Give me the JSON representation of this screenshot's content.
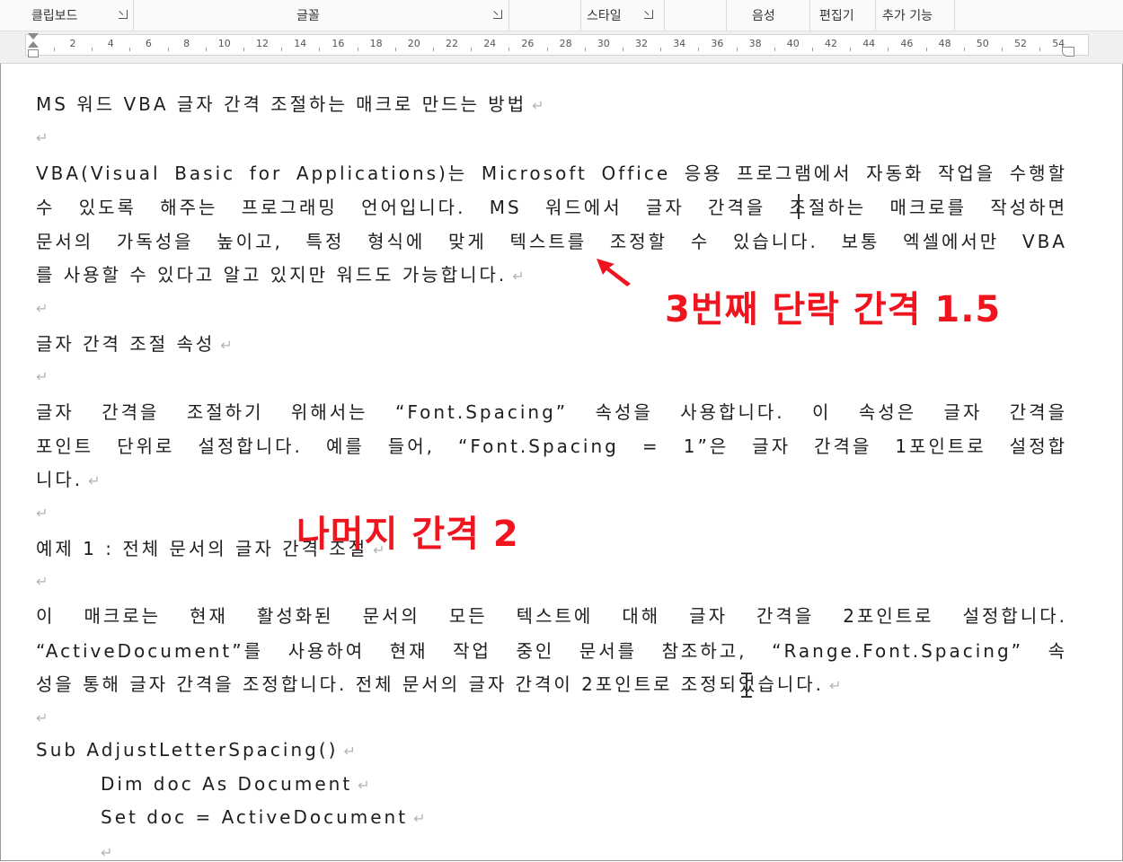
{
  "ribbon": {
    "groups": [
      "클립보드",
      "글꼴",
      "스타일",
      "음성",
      "편집기",
      "추가 기능"
    ]
  },
  "ruler": {
    "numbers": [
      "2",
      "4",
      "6",
      "8",
      "10",
      "12",
      "14",
      "16",
      "18",
      "20",
      "22",
      "24",
      "26",
      "28",
      "30",
      "32",
      "34",
      "36",
      "38",
      "40",
      "42",
      "44",
      "46",
      "48",
      "50",
      "52",
      "54"
    ]
  },
  "document": {
    "title": "MS 워드 VBA 글자 간격 조절하는 매크로 만드는 방법",
    "p1": [
      "VBA(Visual Basic for Applications)는 Microsoft Office 응용 프로그램에서 자동화 작업을 수행할",
      "수 있도록 해주는 프로그래밍 언어입니다. MS 워드에서 글자 간격을 조절하는 매크로를 작성하면",
      "문서의 가독성을 높이고, 특정 형식에 맞게 텍스트를 조정할 수 있습니다. 보통 엑셀에서만 VBA",
      "를 사용할 수 있다고 알고 있지만 워드도 가능합니다."
    ],
    "h2": "글자 간격 조절 속성",
    "p2": [
      "글자 간격을 조절하기 위해서는 “Font.Spacing” 속성을 사용합니다. 이 속성은 글자 간격을",
      "포인트 단위로 설정합니다. 예를 들어, “Font.Spacing = 1”은 글자 간격을 1포인트로 설정합",
      "니다."
    ],
    "h3": "예제 1 : 전체 문서의 글자 간격 조절",
    "p3": [
      "이 매크로는 현재 활성화된 문서의 모든 텍스트에 대해 글자 간격을 2포인트로 설정합니다.",
      "“ActiveDocument”를 사용하여 현재 작업 중인 문서를 참조하고, “Range.Font.Spacing” 속",
      "성을 통해 글자 간격을 조정합니다. 전체 문서의 글자 간격이 2포인트로 조정되었습니다."
    ],
    "code": [
      "Sub AdjustLetterSpacing()",
      "Dim doc As Document",
      "Set doc = ActiveDocument"
    ],
    "mark": "↵"
  },
  "annotations": {
    "note1": "3번째 단락 간격 1.5",
    "note2": "나머지 간격 2"
  },
  "colors": {
    "annotation": "#f0141e",
    "paragraph_mark": "#b3b3b3"
  }
}
